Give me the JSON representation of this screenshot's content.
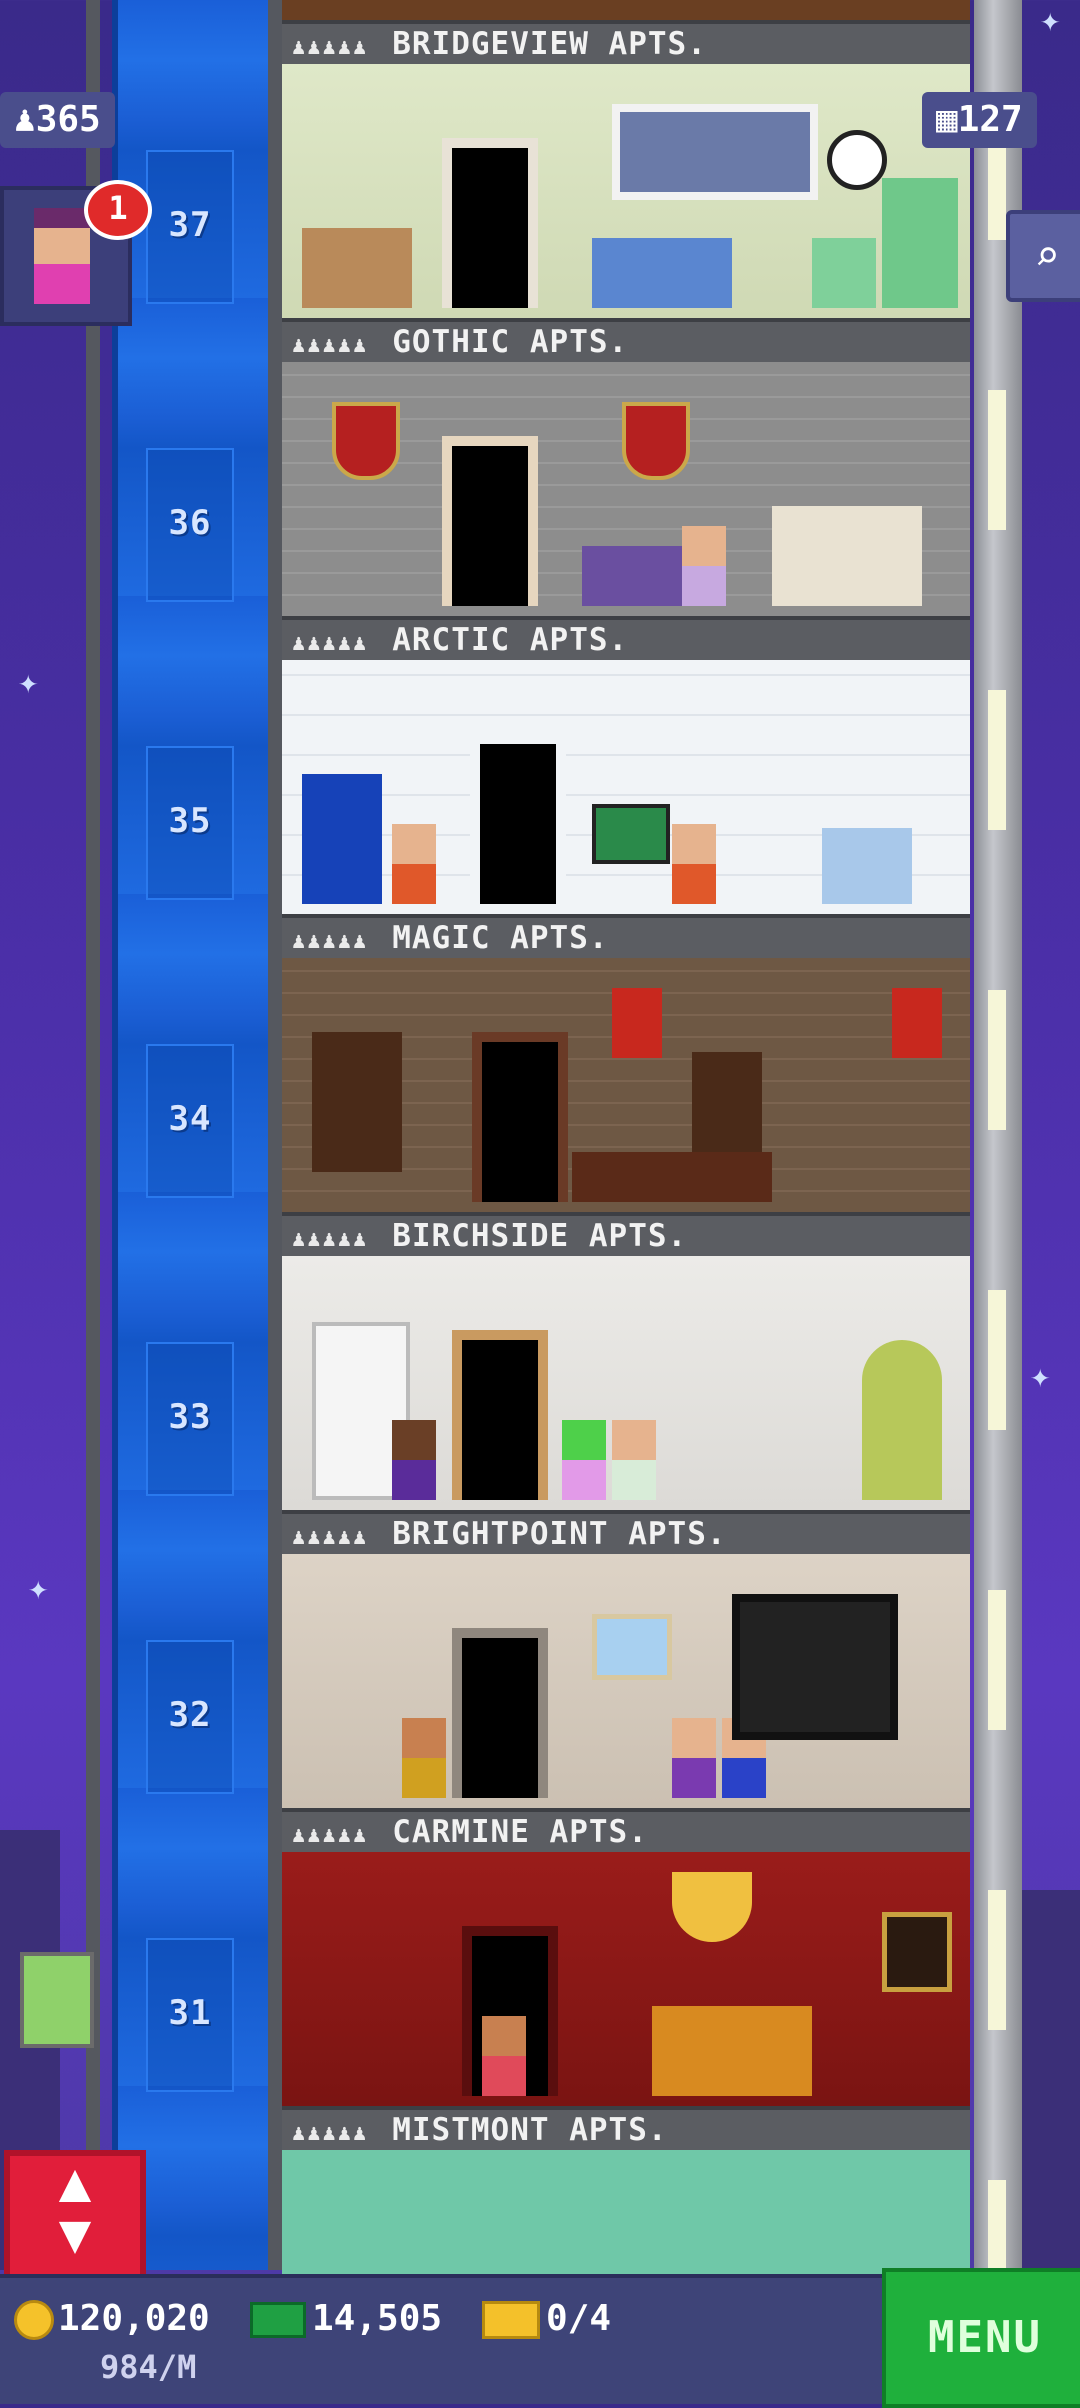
{
  "hud": {
    "population": "365",
    "floors": "127",
    "notification_count": "1"
  },
  "floors": [
    {
      "sign": "BRIDGEVIEW APTS.",
      "number": "37"
    },
    {
      "sign": "GOTHIC APTS.",
      "number": "36"
    },
    {
      "sign": "ARCTIC APTS.",
      "number": "35"
    },
    {
      "sign": "MAGIC APTS.",
      "number": "34"
    },
    {
      "sign": "BIRCHSIDE APTS.",
      "number": "33"
    },
    {
      "sign": "BRIGHTPOINT APTS.",
      "number": "32"
    },
    {
      "sign": "CARMINE APTS.",
      "number": "31"
    },
    {
      "sign": "MISTMONT APTS.",
      "number": ""
    }
  ],
  "bottom_bar": {
    "coins": "120,020",
    "coin_rate": "984/M",
    "tower_bux": "14,505",
    "tickets": "0/4",
    "menu_label": "MENU"
  },
  "colors": {
    "sky": "#4b2fa8",
    "shaft": "#1f6ae0",
    "menu_button": "#1fb03c",
    "elevator_button": "#e11e3a"
  }
}
